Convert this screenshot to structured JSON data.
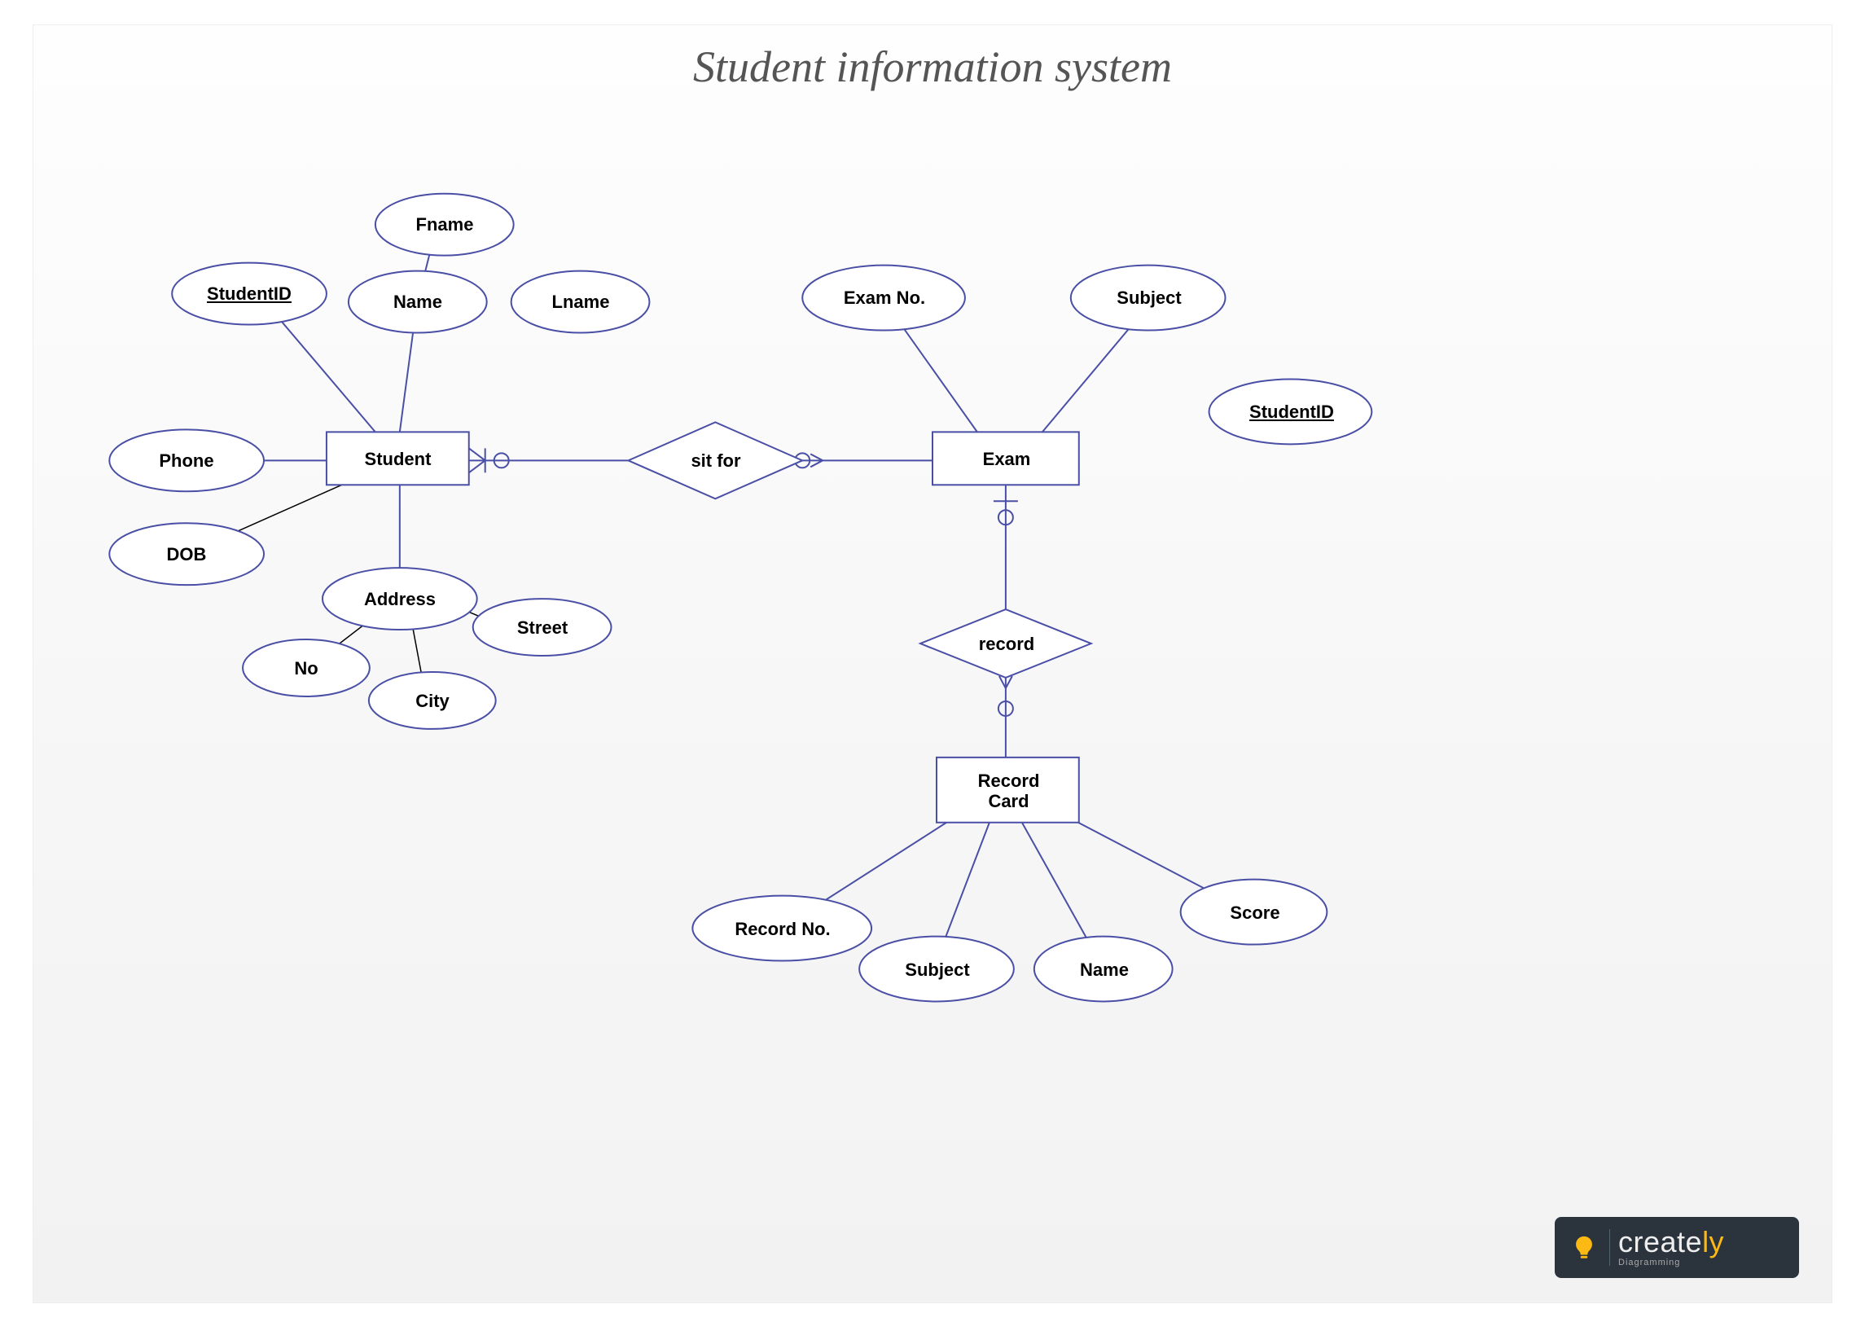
{
  "title": "Student information system",
  "entities": {
    "student": "Student",
    "exam": "Exam",
    "recordcard_l1": "Record",
    "recordcard_l2": "Card"
  },
  "relationships": {
    "sitfor": "sit for",
    "record": "record"
  },
  "attributes": {
    "student_id": "StudentID",
    "phone": "Phone",
    "dob": "DOB",
    "name": "Name",
    "fname": "Fname",
    "lname": "Lname",
    "address": "Address",
    "no": "No",
    "city": "City",
    "street": "Street",
    "exam_no": "Exam No.",
    "subject_exam": "Subject",
    "student_id_exam": "StudentID",
    "record_no": "Record No.",
    "subject_rc": "Subject",
    "name_rc": "Name",
    "score": "Score"
  },
  "logo": {
    "brand_pre": "create",
    "brand_suf": "ly",
    "sub": "Diagramming"
  }
}
